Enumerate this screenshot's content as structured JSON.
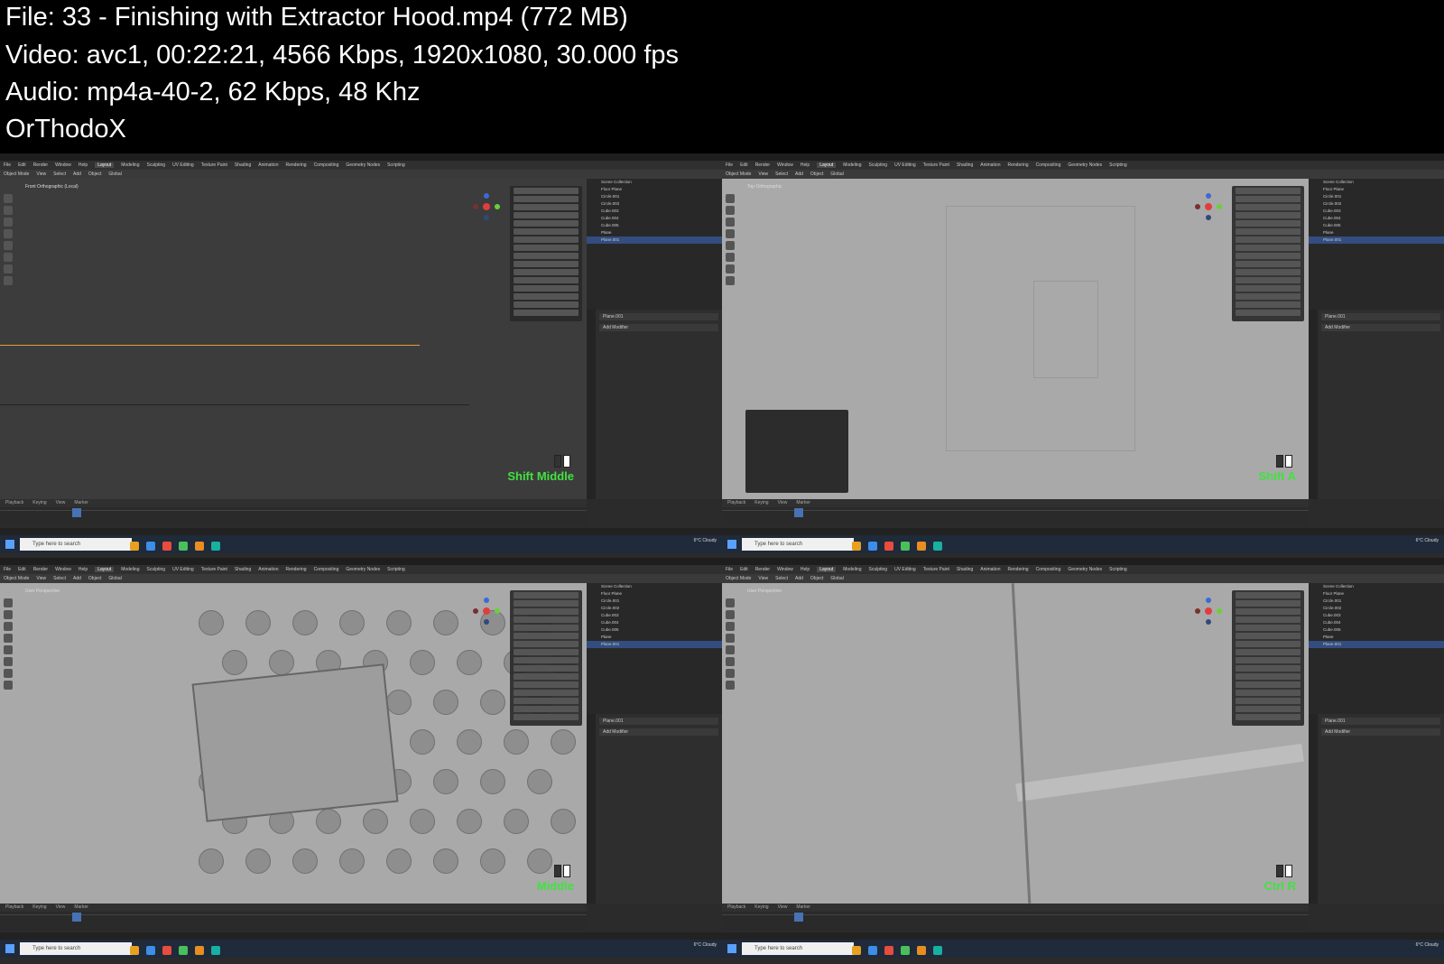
{
  "header": {
    "file": "File: 33 - Finishing with Extractor Hood.mp4 (772 MB)",
    "video": "Video: avc1, 00:22:21, 4566 Kbps, 1920x1080, 30.000 fps",
    "audio": "Audio: mp4a-40-2, 62 Kbps, 48 Khz",
    "author": "OrThodoX"
  },
  "blender": {
    "menu": [
      "File",
      "Edit",
      "Render",
      "Window",
      "Help"
    ],
    "workspaces": [
      "Layout",
      "Modeling",
      "Sculpting",
      "UV Editing",
      "Texture Paint",
      "Shading",
      "Animation",
      "Rendering",
      "Compositing",
      "Geometry Nodes",
      "Scripting"
    ],
    "toolbar": [
      "Object Mode",
      "View",
      "Select",
      "Add",
      "Object",
      "Global"
    ],
    "outliner_items": [
      "Scene Collection",
      "Floor Plane",
      "Circle.001",
      "Circle.002",
      "Cube.003",
      "Cube.004",
      "Cube.005",
      "Plane",
      "Plane.001"
    ],
    "props_header": "Add Modifier",
    "timeline": [
      "Playback",
      "Keying",
      "View",
      "Marker"
    ],
    "taskbar_search": "Type here to search",
    "weather": "6°C Cloudy"
  },
  "panels": [
    {
      "key": "Shift Middle",
      "overlay": "Front Orthographic (Local)"
    },
    {
      "key": "Shift A",
      "overlay": "Top Orthographic"
    },
    {
      "key": "Middle",
      "overlay": "User Perspective"
    },
    {
      "key": "Ctrl R",
      "overlay": "User Perspective"
    }
  ]
}
